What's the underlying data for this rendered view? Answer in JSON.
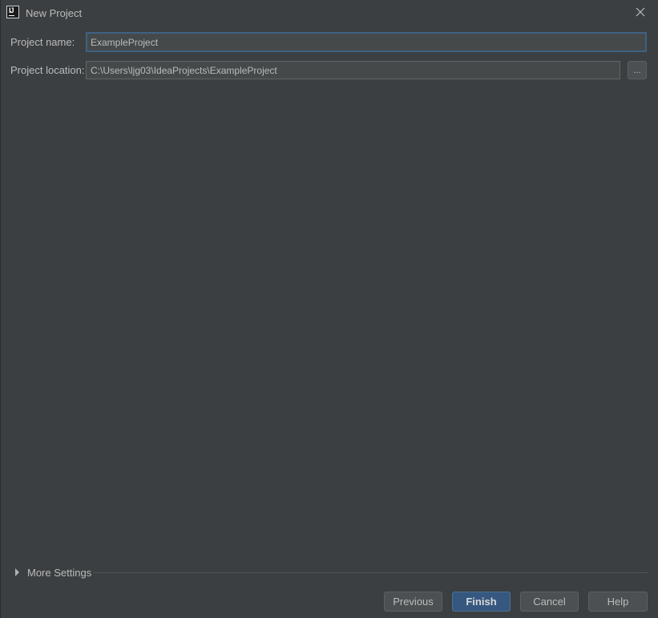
{
  "window": {
    "title": "New Project",
    "app_icon_letters": "IJ"
  },
  "form": {
    "project_name_label": "Project name:",
    "project_name_value": "ExampleProject",
    "project_location_label": "Project location:",
    "project_location_value": "C:\\Users\\ljg03\\IdeaProjects\\ExampleProject",
    "browse_label": "..."
  },
  "more_settings": {
    "label": "More Settings"
  },
  "footer": {
    "previous_label": "Previous",
    "finish_label": "Finish",
    "cancel_label": "Cancel",
    "help_label": "Help"
  },
  "colors": {
    "background": "#3c3f41",
    "field_background": "#45494a",
    "focus_border": "#3d6185",
    "primary_button": "#365880",
    "text": "#bbbbbb"
  },
  "icons": {
    "app": "intellij-idea-icon",
    "close": "close-icon",
    "expand": "triangle-right-icon"
  }
}
